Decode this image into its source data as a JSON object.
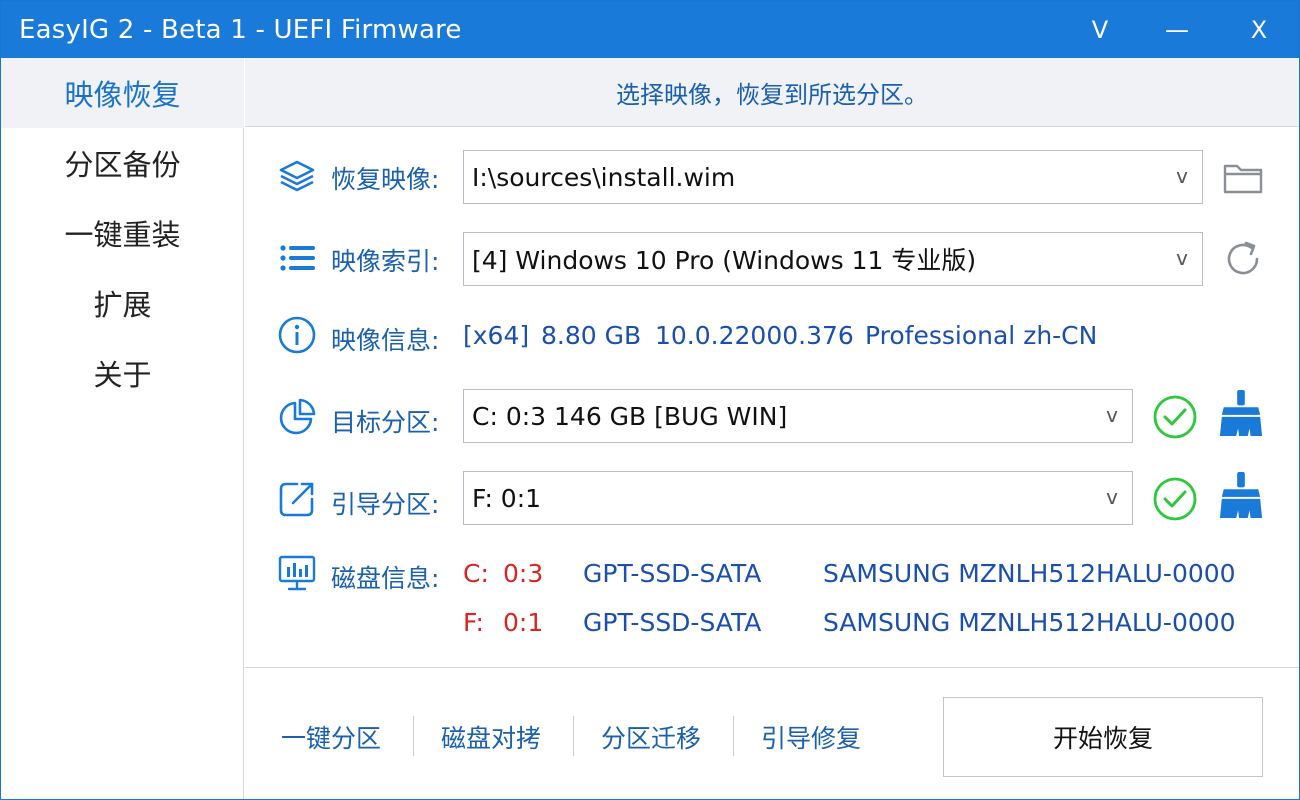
{
  "window": {
    "title": "EasyIG 2 - Beta 1 - UEFI Firmware",
    "controls": {
      "dropdown": "V",
      "minimize": "—",
      "close": "X"
    }
  },
  "sidebar": {
    "items": [
      {
        "label": "映像恢复",
        "active": true
      },
      {
        "label": "分区备份",
        "active": false
      },
      {
        "label": "一键重装",
        "active": false
      },
      {
        "label": "扩展",
        "active": false
      },
      {
        "label": "关于",
        "active": false
      }
    ]
  },
  "header": {
    "text": "选择映像，恢复到所选分区。"
  },
  "form": {
    "restore_image": {
      "label": "恢复映像:",
      "value": "I:\\sources\\install.wim",
      "icon": "layers-icon",
      "action_icon": "folder-icon"
    },
    "image_index": {
      "label": "映像索引:",
      "value": "[4] Windows 10 Pro (Windows 11 专业版)",
      "icon": "list-icon",
      "action_icon": "refresh-icon"
    },
    "image_info": {
      "label": "映像信息:",
      "arch": "[x64]",
      "size": "8.80 GB",
      "build": "10.0.22000.376",
      "edition": "Professional zh-CN",
      "icon": "info-icon"
    },
    "target_partition": {
      "label": "目标分区:",
      "value": "C: 0:3 146 GB [BUG WIN]",
      "icon": "pie-chart-icon"
    },
    "boot_partition": {
      "label": "引导分区:",
      "value": "F: 0:1",
      "icon": "external-link-icon"
    },
    "disk_info": {
      "label": "磁盘信息:",
      "icon": "monitor-chart-icon",
      "rows": [
        {
          "drive": "C:",
          "loc": "0:3",
          "type": "GPT-SSD-SATA",
          "model": "SAMSUNG MZNLH512HALU-0000"
        },
        {
          "drive": "F:",
          "loc": "0:1",
          "type": "GPT-SSD-SATA",
          "model": "SAMSUNG MZNLH512HALU-0000"
        }
      ]
    },
    "chevron": "v"
  },
  "footer": {
    "links": [
      "一键分区",
      "磁盘对拷",
      "分区迁移",
      "引导修复"
    ],
    "start_button": "开始恢复"
  },
  "colors": {
    "accent": "#1a7ad9",
    "link": "#1a5fb0",
    "check": "#2ec83c",
    "drive": "#d22222"
  }
}
